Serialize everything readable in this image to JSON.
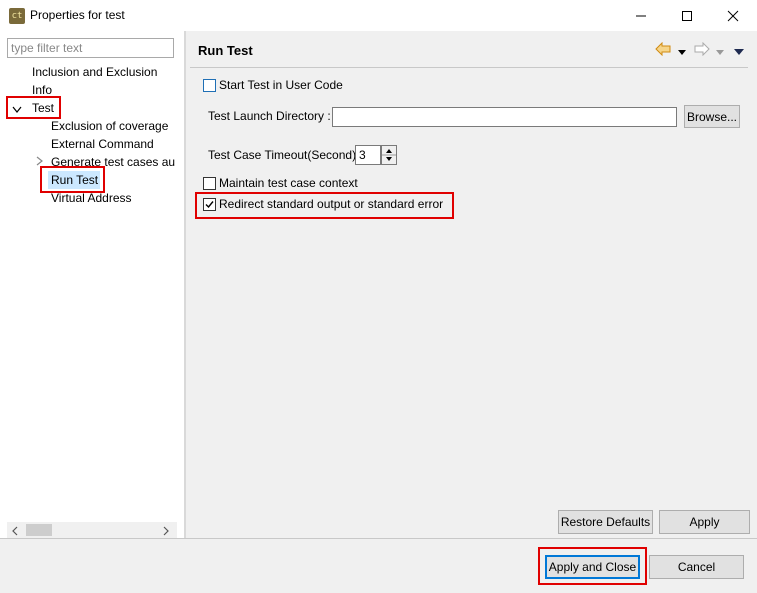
{
  "window": {
    "title": "Properties for test",
    "app_icon_text": "ct",
    "controls": [
      "minimize-icon",
      "maximize-icon",
      "close-icon"
    ]
  },
  "left": {
    "filter_placeholder": "type filter text",
    "tree": {
      "inclusion": "Inclusion and Exclusion",
      "info": "Info",
      "test": "Test",
      "exclusion_coverage": "Exclusion of coverage",
      "external_command": "External Command",
      "generate": "Generate test cases automatically",
      "run_test": "Run Test",
      "virtual_address": "Virtual Address"
    }
  },
  "page": {
    "title": "Run Test",
    "start_test_label": "Start Test in User Code",
    "start_test_checked": false,
    "launch_dir_label": "Test Launch Directory :",
    "launch_dir_value": "",
    "browse_label": "Browse...",
    "timeout_label": "Test Case Timeout(Second)",
    "timeout_value": "3",
    "maintain_label": "Maintain test case context",
    "maintain_checked": false,
    "redirect_label": "Redirect standard output or standard error",
    "redirect_checked": true,
    "restore_defaults_label": "Restore Defaults",
    "apply_label": "Apply"
  },
  "footer": {
    "apply_close_label": "Apply and Close",
    "cancel_label": "Cancel"
  },
  "colors": {
    "highlight_red": "#e00000",
    "selection": "#cce8ff",
    "nav_arrow": "#e0a030"
  }
}
